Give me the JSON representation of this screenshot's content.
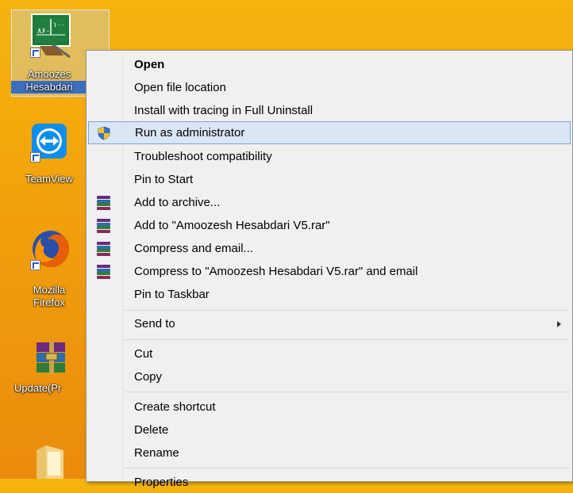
{
  "desktop": {
    "icons": [
      {
        "label_line1": "Amoozes",
        "label_line2": "Hesabdari",
        "icon": "accounting-book-icon"
      },
      {
        "label_line1": "TeamView",
        "icon": "teamviewer-icon"
      },
      {
        "label_line1": "Mozilla",
        "label_line2": "Firefox",
        "icon": "firefox-icon"
      },
      {
        "label_line1": "Update(Pr",
        "icon": "winrar-archive-icon"
      },
      {
        "label_line1": "",
        "icon": "folder-icon"
      }
    ],
    "book_text": "۸۶۰",
    "book_text2": "۱۰۰"
  },
  "context_menu": {
    "items": [
      {
        "label": "Open",
        "bold": true
      },
      {
        "label": "Open file location"
      },
      {
        "label": "Install with tracing in Full Uninstall"
      },
      {
        "label": "Run as administrator",
        "icon": "uac-shield-icon",
        "highlighted": true
      },
      {
        "label": "Troubleshoot compatibility"
      },
      {
        "label": "Pin to Start"
      },
      {
        "label": "Add to archive...",
        "icon": "winrar-icon"
      },
      {
        "label": "Add to \"Amoozesh Hesabdari V5.rar\"",
        "icon": "winrar-icon"
      },
      {
        "label": "Compress and email...",
        "icon": "winrar-icon"
      },
      {
        "label": "Compress to \"Amoozesh Hesabdari V5.rar\" and email",
        "icon": "winrar-icon"
      },
      {
        "label": "Pin to Taskbar"
      },
      {
        "label": "Send to",
        "submenu": true
      },
      {
        "label": "Cut"
      },
      {
        "label": "Copy"
      },
      {
        "label": "Create shortcut"
      },
      {
        "label": "Delete"
      },
      {
        "label": "Rename"
      },
      {
        "label": "Properties"
      }
    ]
  },
  "colors": {
    "desktop": "#f2a50c",
    "menu_bg": "#f0f0f0",
    "highlight_bg": "#dae6f6",
    "highlight_border": "#7ea3d5"
  }
}
